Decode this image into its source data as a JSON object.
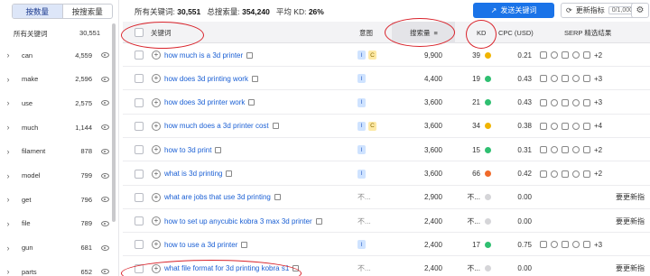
{
  "sidebar": {
    "tabs": [
      {
        "label": "按数量"
      },
      {
        "label": "按搜索量"
      }
    ],
    "header": {
      "label": "所有关键词",
      "count": "30,551"
    },
    "items": [
      {
        "name": "can",
        "count": "4,559"
      },
      {
        "name": "make",
        "count": "2,596"
      },
      {
        "name": "use",
        "count": "2,575"
      },
      {
        "name": "much",
        "count": "1,144"
      },
      {
        "name": "filament",
        "count": "878"
      },
      {
        "name": "model",
        "count": "799"
      },
      {
        "name": "get",
        "count": "796"
      },
      {
        "name": "file",
        "count": "789"
      },
      {
        "name": "gun",
        "count": "681"
      },
      {
        "name": "parts",
        "count": "652"
      }
    ]
  },
  "topbar": {
    "keywords_label": "所有关键词:",
    "keywords_value": "30,551",
    "volume_label": "总搜索量:",
    "volume_value": "354,240",
    "kd_label": "平均 KD:",
    "kd_value": "26%",
    "send_button": "发送关键词",
    "update_button": "更新指标",
    "update_count": "0/1,000"
  },
  "columns": {
    "keyword": "关键词",
    "intent": "意图",
    "volume": "搜索量",
    "kd": "KD",
    "cpc": "CPC (USD)",
    "serp": "SERP 精选结果"
  },
  "rows": [
    {
      "keyword": "how much is a 3d printer",
      "intent": [
        "I",
        "C"
      ],
      "volume": "9,900",
      "kd": "39",
      "kd_color": "#f0b400",
      "cpc": "0.21",
      "serp_more": "+2"
    },
    {
      "keyword": "how does 3d printing work",
      "intent": [
        "I"
      ],
      "volume": "4,400",
      "kd": "19",
      "kd_color": "#2fbf71",
      "cpc": "0.43",
      "serp_more": "+3"
    },
    {
      "keyword": "how does 3d printer work",
      "intent": [
        "I"
      ],
      "volume": "3,600",
      "kd": "21",
      "kd_color": "#2fbf71",
      "cpc": "0.43",
      "serp_more": "+3"
    },
    {
      "keyword": "how much does a 3d printer cost",
      "intent": [
        "I",
        "C"
      ],
      "volume": "3,600",
      "kd": "34",
      "kd_color": "#f0b400",
      "cpc": "0.38",
      "serp_more": "+4"
    },
    {
      "keyword": "how to 3d print",
      "intent": [
        "I"
      ],
      "volume": "3,600",
      "kd": "15",
      "kd_color": "#2fbf71",
      "cpc": "0.31",
      "serp_more": "+2"
    },
    {
      "keyword": "what is 3d printing",
      "intent": [
        "I"
      ],
      "volume": "3,600",
      "kd": "66",
      "kd_color": "#f06a2a",
      "cpc": "0.42",
      "serp_more": "+2"
    },
    {
      "keyword": "what are jobs that use 3d printing",
      "intent_text": "不...",
      "volume": "2,900",
      "kd": "不...",
      "kd_color": "#d5d5d8",
      "cpc": "0.00",
      "serp_text": "要更新指"
    },
    {
      "keyword": "how to set up anycubic kobra 3 max 3d printer",
      "intent_text": "不...",
      "volume": "2,400",
      "kd": "不...",
      "kd_color": "#d5d5d8",
      "cpc": "0.00",
      "serp_text": "要更新指"
    },
    {
      "keyword": "how to use a 3d printer",
      "intent": [
        "I"
      ],
      "volume": "2,400",
      "kd": "17",
      "kd_color": "#2fbf71",
      "cpc": "0.75",
      "serp_more": "+3"
    },
    {
      "keyword": "what file format for 3d printing kobra s1",
      "intent_text": "不...",
      "volume": "2,400",
      "kd": "不...",
      "kd_color": "#d5d5d8",
      "cpc": "0.00",
      "serp_text": "要更新指"
    }
  ]
}
